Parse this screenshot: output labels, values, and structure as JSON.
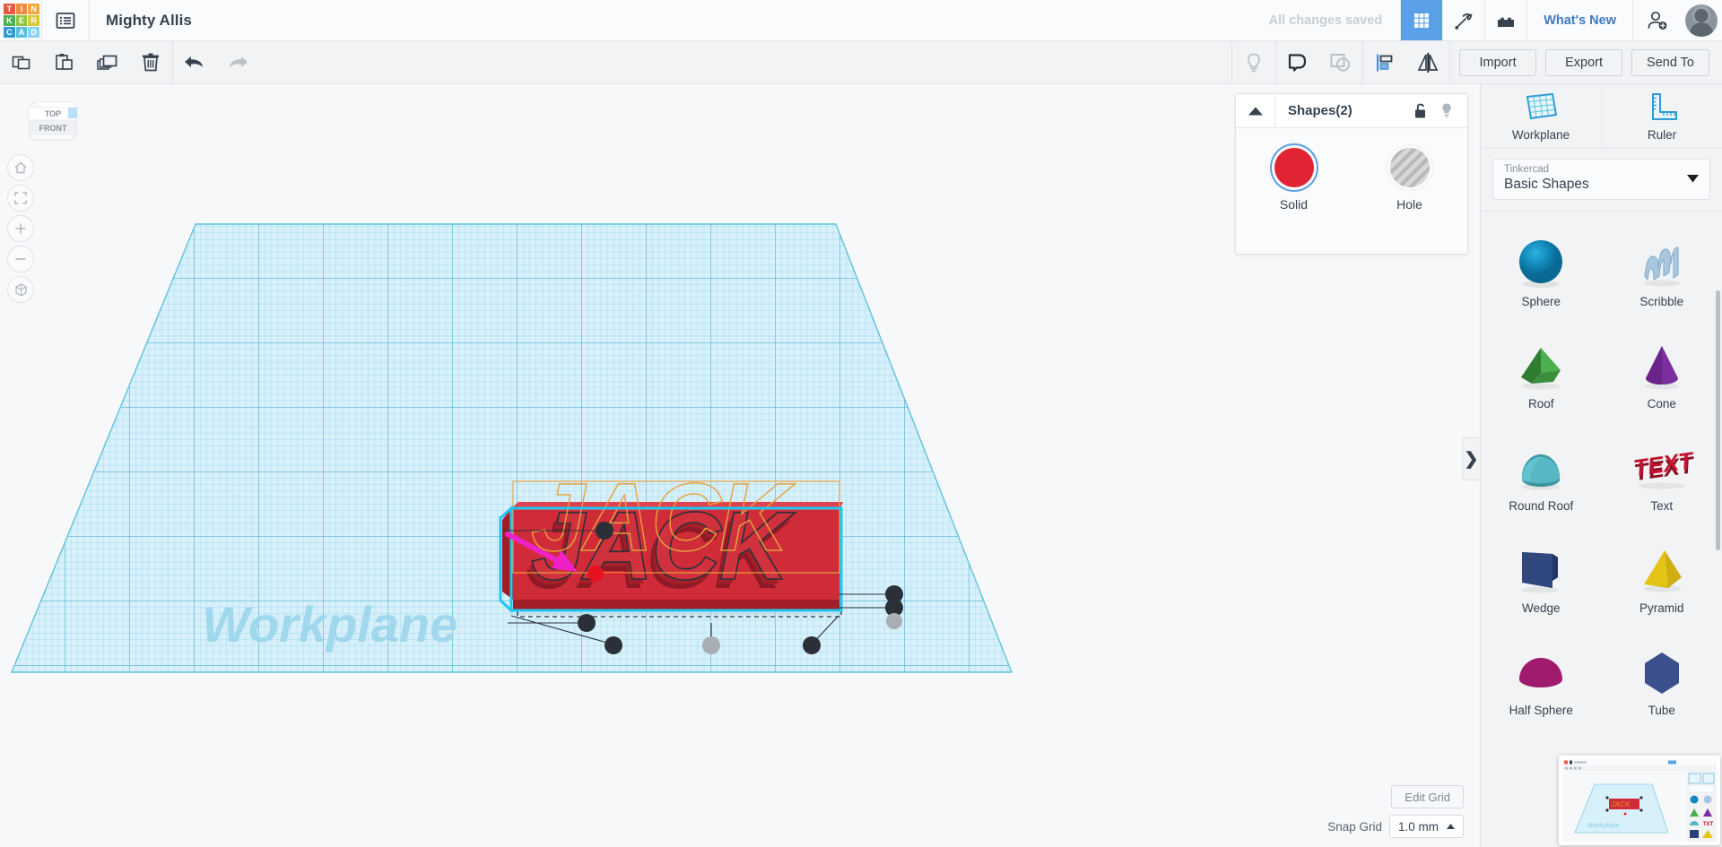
{
  "app": {
    "brand_letters": [
      "T",
      "I",
      "N",
      "K",
      "E",
      "R",
      "C",
      "A",
      "D"
    ],
    "brand_colors": [
      "#e8583a",
      "#f08a3c",
      "#f0a73c",
      "#4caf50",
      "#8cc63f",
      "#d4c83c",
      "#2e9bd6",
      "#5bc0de",
      "#8ad4f0"
    ],
    "document_title": "Mighty Allis",
    "save_status": "All changes saved",
    "whats_new_label": "What's New"
  },
  "topbar_icons": [
    {
      "name": "grid-icon",
      "active": true
    },
    {
      "name": "pickaxe-icon",
      "active": false
    },
    {
      "name": "brick-icon",
      "active": false
    }
  ],
  "toolbar": {
    "left_tools": [
      {
        "name": "copy-icon",
        "label": "Copy",
        "dim": false
      },
      {
        "name": "paste-icon",
        "label": "Paste",
        "dim": false
      },
      {
        "name": "duplicate-icon",
        "label": "Duplicate",
        "dim": false
      },
      {
        "name": "delete-icon",
        "label": "Delete",
        "dim": false
      },
      {
        "name": "undo-icon",
        "label": "Undo",
        "dim": false
      },
      {
        "name": "redo-icon",
        "label": "Redo",
        "dim": true
      }
    ],
    "right_tools": [
      {
        "name": "lightbulb-icon",
        "label": "Note",
        "dim": true
      },
      {
        "name": "group-icon",
        "label": "Group",
        "dim": false
      },
      {
        "name": "ungroup-icon",
        "label": "Ungroup",
        "dim": true
      },
      {
        "name": "align-icon",
        "label": "Align",
        "dim": false
      },
      {
        "name": "mirror-icon",
        "label": "Mirror",
        "dim": false
      }
    ],
    "buttons": [
      {
        "label": "Import",
        "name": "import-button"
      },
      {
        "label": "Export",
        "name": "export-button"
      },
      {
        "label": "Send To",
        "name": "send-to-button"
      }
    ]
  },
  "canvas": {
    "view_cube": {
      "top_label": "TOP",
      "front_label": "FRONT"
    },
    "nav_buttons": [
      {
        "name": "home-view-button",
        "label": "Home view"
      },
      {
        "name": "fit-to-view-button",
        "label": "Fit all in view"
      },
      {
        "name": "zoom-in-button",
        "label": "Zoom in"
      },
      {
        "name": "zoom-out-button",
        "label": "Zoom out"
      },
      {
        "name": "orthographic-toggle-button",
        "label": "Switch to orthographic view"
      }
    ],
    "workplane_label": "Workplane",
    "collapse_tab_glyph": "❯",
    "edit_grid_label": "Edit Grid",
    "snap_grid_label": "Snap Grid",
    "snap_grid_value": "1.0 mm",
    "object": {
      "text": "JACK",
      "color": "#cf2b38",
      "selection_outline_color": "#1ec7f0",
      "wireframe_color": "#e8a33d",
      "pointer_arrow_color": "#f020c8",
      "active_handle_color": "#e8111f"
    },
    "grid_colors": {
      "fill": "#ddf2fb",
      "line": "#7fd1ea",
      "major_line": "#3ba8cf"
    }
  },
  "shapes_panel": {
    "title": "Shapes(2)",
    "caret_glyph": "▲",
    "icons": [
      {
        "name": "unlock-icon"
      },
      {
        "name": "lightbulb-icon"
      }
    ],
    "options": [
      {
        "label": "Solid",
        "name": "solid-swatch",
        "color": "#e02434",
        "selected": true
      },
      {
        "label": "Hole",
        "name": "hole-swatch",
        "color": "#c4c4c4",
        "selected": false
      }
    ]
  },
  "sidebar": {
    "top_tools": [
      {
        "label": "Workplane",
        "name": "workplane-tool"
      },
      {
        "label": "Ruler",
        "name": "ruler-tool"
      }
    ],
    "library_select": {
      "owner": "Tinkercad",
      "collection": "Basic Shapes",
      "caret_glyph": "▼"
    },
    "shapes": [
      {
        "label": "Sphere",
        "name": "shape-sphere",
        "color": "#1287b8"
      },
      {
        "label": "Scribble",
        "name": "shape-scribble",
        "color": "#a9c8e0"
      },
      {
        "label": "Roof",
        "name": "shape-roof",
        "color": "#3fa544"
      },
      {
        "label": "Cone",
        "name": "shape-cone",
        "color": "#7b2f9e"
      },
      {
        "label": "Round Roof",
        "name": "shape-round-roof",
        "color": "#58b7c4"
      },
      {
        "label": "Text",
        "name": "shape-text",
        "color": "#c41230"
      },
      {
        "label": "Wedge",
        "name": "shape-wedge",
        "color": "#2b3f78"
      },
      {
        "label": "Pyramid",
        "name": "shape-pyramid",
        "color": "#e3c417"
      },
      {
        "label": "Half Sphere",
        "name": "shape-half-sphere",
        "color": "#a01a6e"
      },
      {
        "label": "Tube",
        "name": "shape-tube",
        "color": "#3b4f8c"
      }
    ]
  }
}
